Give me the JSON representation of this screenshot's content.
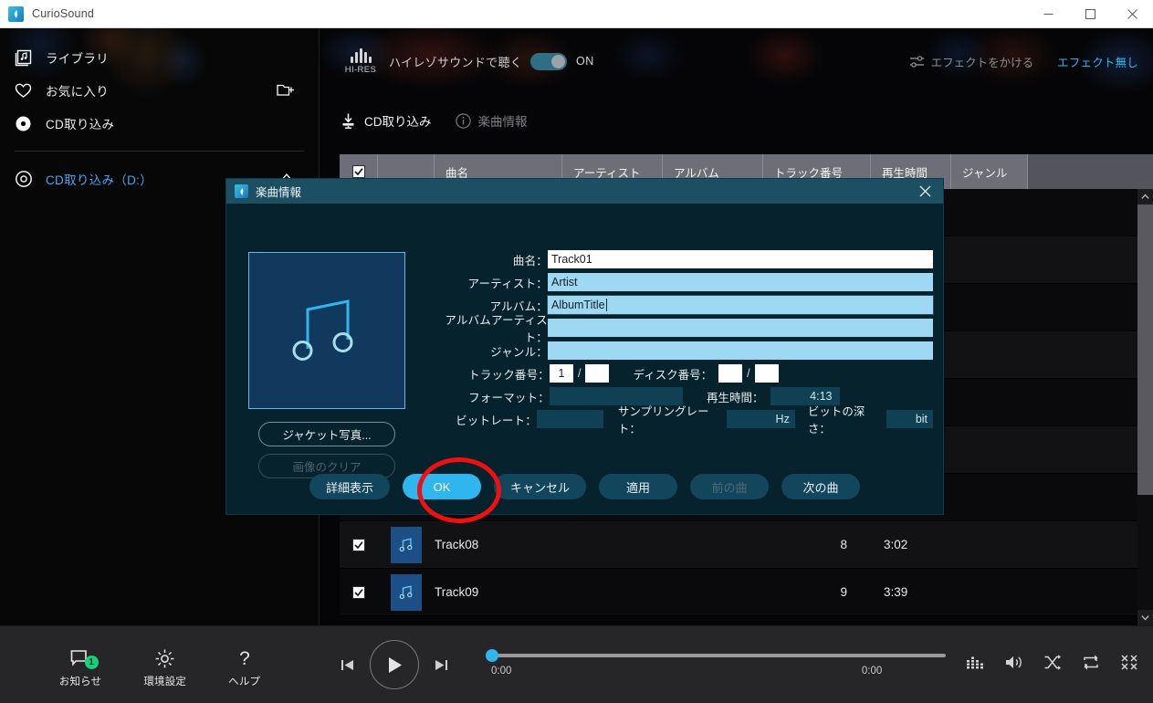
{
  "window": {
    "title": "CurioSound",
    "logo_icon": "app-logo-icon",
    "minimize_icon": "minimize-icon",
    "maximize_icon": "maximize-icon",
    "close_icon": "close-icon"
  },
  "sidebar": {
    "items": [
      {
        "label": "ライブラリ",
        "icon": "library-icon"
      },
      {
        "label": "お気に入り",
        "icon": "heart-icon",
        "trailing_icon": "new-folder-icon"
      },
      {
        "label": "CD取り込み",
        "icon": "disc-filled-icon"
      }
    ],
    "drive": {
      "label": "CD取り込み（D:）",
      "icon": "disc-outline-icon",
      "trailing_icon": "eject-icon"
    }
  },
  "hires": {
    "badge_text": "HI-RES",
    "badge_icon": "hires-bars-icon",
    "label": "ハイレゾサウンドで聴く",
    "toggle_state": "ON",
    "toggle_on": true
  },
  "effects": {
    "apply_label": "エフェクトをかける",
    "apply_icon": "sliders-icon",
    "current_label": "エフェクト無し",
    "accent_color": "#2fb6ef"
  },
  "tabs": [
    {
      "label": "CD取り込み",
      "icon": "import-cd-icon",
      "active": true
    },
    {
      "label": "楽曲情報",
      "icon": "info-circle-icon",
      "active": false
    }
  ],
  "table": {
    "select_all_icon": "checkbox-checked-icon",
    "headers": [
      "曲名",
      "アーティスト",
      "アルバム",
      "トラック番号",
      "再生時間",
      "ジャンル"
    ],
    "rows": [
      {
        "checked": true,
        "title": "",
        "artist": "",
        "album": "",
        "track_no": "",
        "duration": "",
        "genre": "",
        "hidden": true
      },
      {
        "checked": true,
        "title": "",
        "artist": "",
        "album": "",
        "track_no": "",
        "duration": "",
        "genre": "",
        "hidden": true
      },
      {
        "checked": true,
        "title": "",
        "artist": "",
        "album": "",
        "track_no": "",
        "duration": "",
        "genre": "",
        "hidden": true
      },
      {
        "checked": true,
        "title": "",
        "artist": "",
        "album": "",
        "track_no": "",
        "duration": "",
        "genre": "",
        "hidden": true
      },
      {
        "checked": true,
        "title": "",
        "artist": "",
        "album": "",
        "track_no": "",
        "duration": "",
        "genre": "",
        "hidden": true
      },
      {
        "checked": true,
        "title": "",
        "artist": "",
        "album": "",
        "track_no": "",
        "duration": "",
        "genre": "",
        "hidden": true
      },
      {
        "checked": true,
        "title": "",
        "artist": "",
        "album": "",
        "track_no": "",
        "duration": "",
        "genre": "",
        "hidden": true
      },
      {
        "checked": true,
        "title": "Track08",
        "artist": "",
        "album": "",
        "track_no": "8",
        "duration": "3:02",
        "genre": "",
        "hidden": false
      },
      {
        "checked": true,
        "title": "Track09",
        "artist": "",
        "album": "",
        "track_no": "9",
        "duration": "3:39",
        "genre": "",
        "hidden": false
      }
    ],
    "scroll_up_icon": "chevron-up-icon",
    "scroll_down_icon": "chevron-down-icon"
  },
  "dialog": {
    "title": "楽曲情報",
    "logo_icon": "app-logo-icon",
    "close_icon": "close-icon",
    "jacket_icon": "music-note-icon",
    "jacket_button": "ジャケット写真...",
    "clear_button": "画像のクリア",
    "fields": {
      "title": {
        "label": "曲名：",
        "value": "Track01"
      },
      "artist": {
        "label": "アーティスト：",
        "value": "Artist"
      },
      "album": {
        "label": "アルバム：",
        "value": "AlbumTitle"
      },
      "album_artist": {
        "label": "アルバムアーティスト：",
        "value": ""
      },
      "genre": {
        "label": "ジャンル：",
        "value": ""
      },
      "track_no": {
        "label": "トラック番号：",
        "value": "1",
        "total": ""
      },
      "disc_no": {
        "label": "ディスク番号：",
        "value": "",
        "total": ""
      },
      "format": {
        "label": "フォーマット：",
        "value": ""
      },
      "duration": {
        "label": "再生時間：",
        "value": "4:13"
      },
      "bitrate": {
        "label": "ビットレート：",
        "value": ""
      },
      "sample_rate": {
        "label": "サンプリングレート：",
        "value": "Hz"
      },
      "bit_depth": {
        "label": "ビットの深さ：",
        "value": "bit"
      }
    },
    "buttons": [
      {
        "label": "詳細表示",
        "style": "normal"
      },
      {
        "label": "OK",
        "style": "primary"
      },
      {
        "label": "キャンセル",
        "style": "normal"
      },
      {
        "label": "適用",
        "style": "normal"
      },
      {
        "label": "前の曲",
        "style": "disabled"
      },
      {
        "label": "次の曲",
        "style": "normal"
      }
    ]
  },
  "annotation": {
    "shape": "red-ellipse",
    "target": "OK",
    "color": "#f01010"
  },
  "bottom": {
    "utils": [
      {
        "label": "お知らせ",
        "icon": "notification-icon",
        "badge": "1",
        "badge_color": "#17d07e"
      },
      {
        "label": "環境設定",
        "icon": "gear-icon",
        "badge": ""
      },
      {
        "label": "ヘルプ",
        "icon": "question-mark-icon",
        "badge": ""
      }
    ],
    "transport": {
      "prev_icon": "previous-track-icon",
      "play_icon": "play-icon",
      "next_icon": "next-track-icon"
    },
    "seek": {
      "elapsed": "0:00",
      "total": "0:00",
      "progress_percent": 0
    },
    "right_icons": [
      "equalizer-icon",
      "volume-icon",
      "shuffle-icon",
      "repeat-icon",
      "collapse-icon"
    ]
  }
}
